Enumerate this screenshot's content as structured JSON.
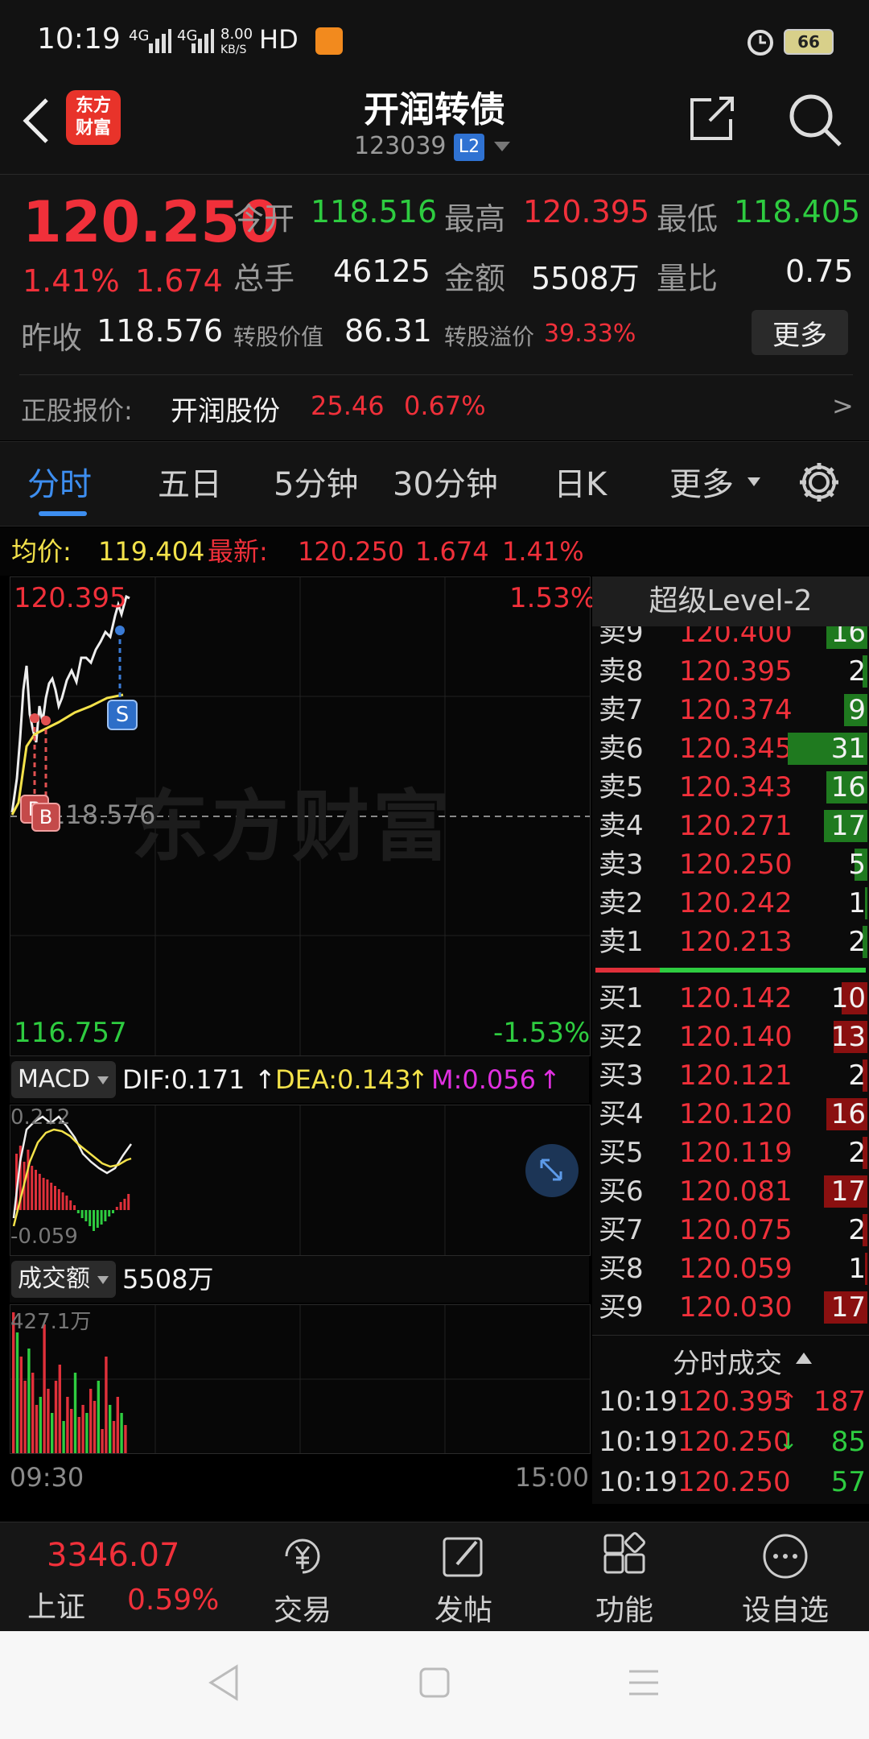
{
  "status_bar": {
    "time": "10:19",
    "net1": "4G",
    "net2": "4G",
    "speed_top": "8.00",
    "speed_unit": "KB/S",
    "hd": "HD",
    "battery": "66"
  },
  "header": {
    "logo_line1": "东方",
    "logo_line2": "财富",
    "title": "开润转债",
    "code": "123039",
    "badge": "L2"
  },
  "quote": {
    "price": "120.250",
    "pct": "1.41%",
    "chg": "1.674",
    "open_label": "今开",
    "open": "118.516",
    "high_label": "最高",
    "high": "120.395",
    "low_label": "最低",
    "low": "118.405",
    "vol_label": "总手",
    "vol": "46125",
    "amt_label": "金额",
    "amt": "5508万",
    "ratio_label": "量比",
    "ratio": "0.75",
    "prev_label": "昨收",
    "prev": "118.576",
    "conv_label": "转股价值",
    "conv": "86.31",
    "prem_label": "转股溢价",
    "prem": "39.33%",
    "more": "更多",
    "stock_label": "正股报价:",
    "stock_name": "开润股份",
    "stock_price": "25.46",
    "stock_pct": "0.67%",
    "arrow": ">"
  },
  "tabs": {
    "t1": "分时",
    "t2": "五日",
    "t3": "5分钟",
    "t4": "30分钟",
    "t5": "日K",
    "t6": "更多"
  },
  "info": {
    "avg_label": "均价:",
    "avg": "119.404",
    "new_label": "最新:",
    "new": "120.250",
    "chg": "1.674",
    "pct": "1.41%"
  },
  "chart": {
    "top_price": "120.395",
    "top_pct": "1.53%",
    "mid": "118.576",
    "bot_price": "116.757",
    "bot_pct": "-1.53%",
    "watermark": "东方财富",
    "marker": "S",
    "marker2": "B"
  },
  "macd": {
    "label": "MACD",
    "dif": "DIF:0.171",
    "dea": "DEA:0.143",
    "m": "M:0.056",
    "top": "0.212",
    "bot": "-0.059"
  },
  "volume": {
    "label": "成交额",
    "value": "5508万",
    "top": "427.1万",
    "t_start": "09:30",
    "t_end": "15:00"
  },
  "level2": {
    "title": "超级Level-2",
    "sells": [
      {
        "label": "卖9",
        "price": "120.400",
        "qty": "16"
      },
      {
        "label": "卖8",
        "price": "120.395",
        "qty": "2"
      },
      {
        "label": "卖7",
        "price": "120.374",
        "qty": "9"
      },
      {
        "label": "卖6",
        "price": "120.345",
        "qty": "31"
      },
      {
        "label": "卖5",
        "price": "120.343",
        "qty": "16"
      },
      {
        "label": "卖4",
        "price": "120.271",
        "qty": "17"
      },
      {
        "label": "卖3",
        "price": "120.250",
        "qty": "5"
      },
      {
        "label": "卖2",
        "price": "120.242",
        "qty": "1"
      },
      {
        "label": "卖1",
        "price": "120.213",
        "qty": "2"
      }
    ],
    "buys": [
      {
        "label": "买1",
        "price": "120.142",
        "qty": "10"
      },
      {
        "label": "买2",
        "price": "120.140",
        "qty": "13"
      },
      {
        "label": "买3",
        "price": "120.121",
        "qty": "2"
      },
      {
        "label": "买4",
        "price": "120.120",
        "qty": "16"
      },
      {
        "label": "买5",
        "price": "120.119",
        "qty": "2"
      },
      {
        "label": "买6",
        "price": "120.081",
        "qty": "17"
      },
      {
        "label": "买7",
        "price": "120.075",
        "qty": "2"
      },
      {
        "label": "买8",
        "price": "120.059",
        "qty": "1"
      },
      {
        "label": "买9",
        "price": "120.030",
        "qty": "17"
      }
    ],
    "trades_title": "分时成交",
    "trades": [
      {
        "time": "10:19",
        "price": "120.395",
        "dir": "↑",
        "qty": "187"
      },
      {
        "time": "10:19",
        "price": "120.250",
        "dir": "↓",
        "qty": "85"
      },
      {
        "time": "10:19",
        "price": "120.250",
        "dir": "",
        "qty": "57"
      }
    ]
  },
  "bottom": {
    "index_value": "3346.07",
    "index_name": "上证",
    "index_pct": "0.59%",
    "nav1": "交易",
    "nav2": "发帖",
    "nav3": "功能",
    "nav4": "设自选"
  },
  "colors": {
    "red": "#f0303a",
    "green": "#2ecc40",
    "yellow": "#f3e24a",
    "blue": "#3a7bd5"
  }
}
